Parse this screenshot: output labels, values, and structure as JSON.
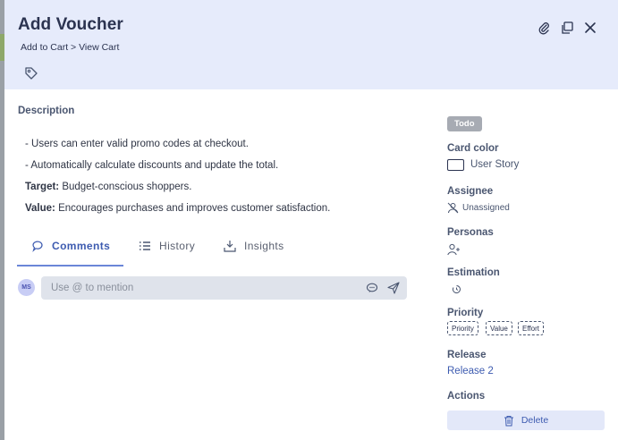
{
  "header": {
    "title": "Add Voucher",
    "breadcrumb": "Add to Cart > View Cart"
  },
  "description": {
    "heading": "Description",
    "lines": [
      "- Users can enter valid promo codes at checkout.",
      "- Automatically calculate discounts and update the total."
    ],
    "target_label": "Target:",
    "target_text": " Budget-conscious shoppers.",
    "value_label": "Value:",
    "value_text": " Encourages purchases and improves customer satisfaction."
  },
  "tabs": [
    {
      "label": "Comments",
      "icon": "comment-icon",
      "active": true
    },
    {
      "label": "History",
      "icon": "list-icon",
      "active": false
    },
    {
      "label": "Insights",
      "icon": "insights-icon",
      "active": false
    }
  ],
  "comment": {
    "avatar_initials": "MS",
    "placeholder": "Use @ to mention"
  },
  "sidebar": {
    "status": "Todo",
    "card_color_label": "Card color",
    "card_color_value": "User Story",
    "assignee_label": "Assignee",
    "assignee_value": "Unassigned",
    "personas_label": "Personas",
    "estimation_label": "Estimation",
    "priority_label": "Priority",
    "priority_chips": [
      "Priority",
      "Value",
      "Effort"
    ],
    "release_label": "Release",
    "release_value": "Release 2",
    "actions_label": "Actions",
    "delete_label": "Delete"
  },
  "colors": {
    "header_bg": "#e6ebfb",
    "accent": "#3d5bb0",
    "status_badge": "#a7abb3"
  }
}
